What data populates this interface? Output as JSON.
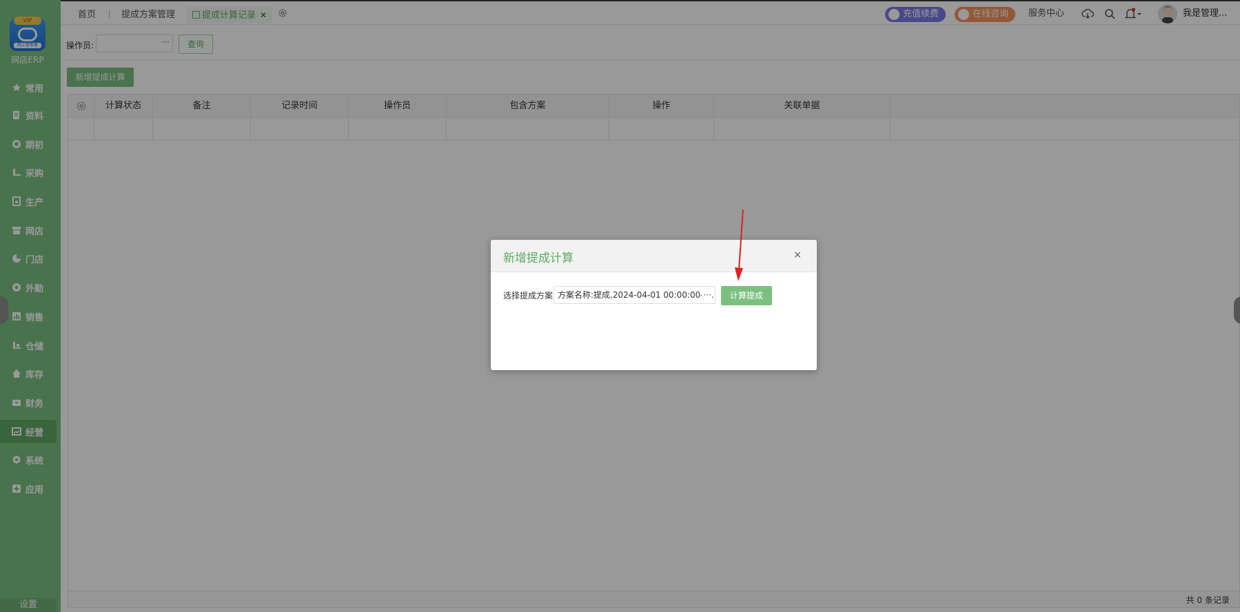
{
  "brand": {
    "name": "网店ERP",
    "logo_badge": "VIP",
    "logo_sub": "网上管家婆"
  },
  "sidebar": {
    "items": [
      {
        "label": "常用",
        "icon": "star-icon"
      },
      {
        "label": "资料",
        "icon": "document-icon"
      },
      {
        "label": "期初",
        "icon": "target-icon"
      },
      {
        "label": "采购",
        "icon": "cart-icon"
      },
      {
        "label": "生产",
        "icon": "production-icon"
      },
      {
        "label": "网店",
        "icon": "store-icon"
      },
      {
        "label": "门店",
        "icon": "pie-icon"
      },
      {
        "label": "外勤",
        "icon": "field-icon"
      },
      {
        "label": "销售",
        "icon": "bar-chart-icon"
      },
      {
        "label": "仓储",
        "icon": "warehouse-icon"
      },
      {
        "label": "库存",
        "icon": "home-icon"
      },
      {
        "label": "财务",
        "icon": "wallet-icon"
      },
      {
        "label": "经营",
        "icon": "business-icon"
      },
      {
        "label": "系统",
        "icon": "hex-gear-icon"
      },
      {
        "label": "应用",
        "icon": "plus-square-icon"
      }
    ],
    "active_item": "经营",
    "settings_label": "设置"
  },
  "tabs": {
    "home": "首页",
    "scheme_manage": "提成方案管理",
    "calc_records": "提成计算记录",
    "close_glyph": "✕"
  },
  "topbar": {
    "recharge": "充值续费",
    "consult": "在线咨询",
    "service_center": "服务中心",
    "user_name": "我是管理..."
  },
  "query": {
    "operator_label": "操作员:",
    "operator_value": "",
    "more_glyph": "···",
    "query_button": "查询"
  },
  "toolbar": {
    "add_button": "新增提成计算"
  },
  "grid": {
    "columns": [
      "计算状态",
      "备注",
      "记录时间",
      "操作员",
      "包含方案",
      "操作",
      "关联单据"
    ],
    "rows": [],
    "footer": "共 0 条记录"
  },
  "dialog": {
    "title": "新增提成计算",
    "close_glyph": "×",
    "scheme_label": "选择提成方案",
    "scheme_value": "方案名称:提成,2024-04-01 00:00:00-2...",
    "calc_button": "计算提成"
  },
  "colors": {
    "accent": "#7bc07f",
    "accent_text": "#5aad5f",
    "recharge_pill": "#7b78e6",
    "consult_pill": "#f7935a",
    "annotation_arrow": "#e02020"
  }
}
